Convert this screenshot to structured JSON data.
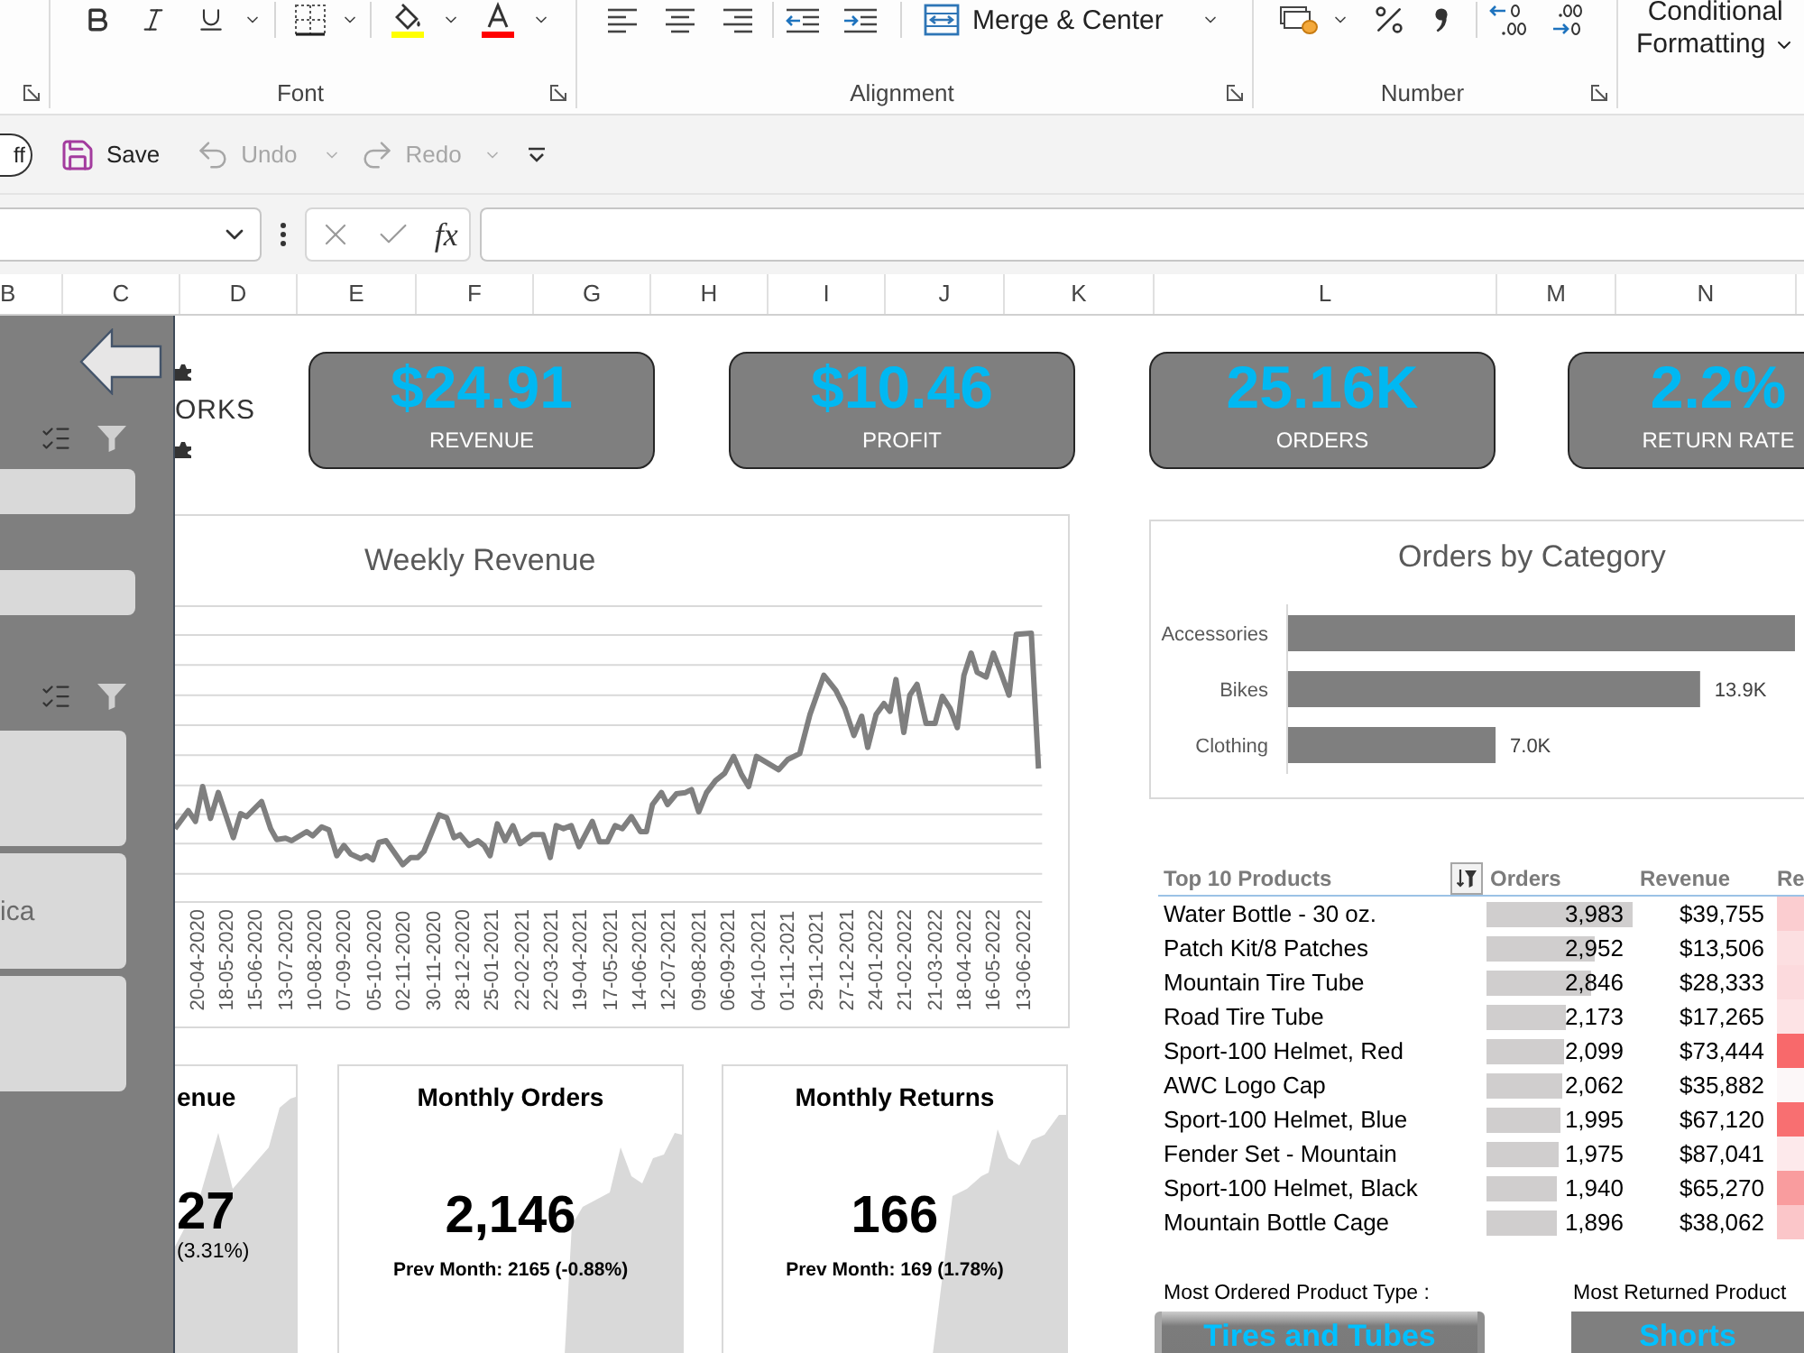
{
  "ribbon": {
    "groups": [
      {
        "kind": "font",
        "label": "Font"
      },
      {
        "kind": "alignment",
        "label": "Alignment",
        "merge_label": "Merge & Center"
      },
      {
        "kind": "number",
        "label": "Number"
      }
    ],
    "styles": {
      "lines": [
        "Conditional",
        "Formatting"
      ]
    }
  },
  "quick_access": {
    "toggle": {
      "label": "ff",
      "on": false
    },
    "buttons": [
      {
        "kind": "save",
        "label": "Save",
        "disabled": false
      },
      {
        "kind": "undo",
        "label": "Undo",
        "disabled": true
      },
      {
        "kind": "redo",
        "label": "Redo",
        "disabled": true
      }
    ]
  },
  "formula_bar": {
    "function_label": "fx"
  },
  "columns": [
    "B",
    "C",
    "D",
    "E",
    "F",
    "G",
    "H",
    "I",
    "J",
    "K",
    "L",
    "M",
    "N"
  ],
  "slicer_panel": {
    "slicers": [
      {
        "items": [
          {
            "selected": true
          },
          {
            "selected": true
          }
        ]
      },
      {
        "items": [
          {
            "selected": true
          },
          {
            "label": "ica",
            "selected": true
          },
          {
            "selected": true
          }
        ]
      }
    ]
  },
  "logo": {
    "text": "ORKS"
  },
  "kpis": [
    {
      "value": "$24.91",
      "label": "REVENUE"
    },
    {
      "value": "$10.46",
      "label": "PROFIT"
    },
    {
      "value": "25.16K",
      "label": "ORDERS"
    },
    {
      "value": "2.2%",
      "label": "RETURN RATE"
    }
  ],
  "weekly_revenue": {
    "title": "Weekly Revenue",
    "x_labels": [
      "20-04-2020",
      "18-05-2020",
      "15-06-2020",
      "13-07-2020",
      "10-08-2020",
      "07-09-2020",
      "05-10-2020",
      "02-11-2020",
      "30-11-2020",
      "28-12-2020",
      "25-01-2021",
      "22-02-2021",
      "22-03-2021",
      "19-04-2021",
      "17-05-2021",
      "14-06-2021",
      "12-07-2021",
      "09-08-2021",
      "06-09-2021",
      "04-10-2021",
      "01-11-2021",
      "29-11-2021",
      "27-12-2021",
      "24-01-2022",
      "21-02-2022",
      "21-03-2022",
      "18-04-2022",
      "16-05-2022",
      "13-06-2022"
    ]
  },
  "orders_by_category": {
    "chart_data": {
      "type": "bar",
      "orientation": "horizontal",
      "title": "Orders by Category",
      "categories": [
        "Accessories",
        "Bikes",
        "Clothing"
      ],
      "values": [
        17.1,
        13.9,
        7.0
      ],
      "value_labels": [
        null,
        "13.9K",
        "7.0K"
      ]
    }
  },
  "top_products": {
    "columns": [
      "Top 10 Products",
      "Orders",
      "Revenue",
      "Re"
    ],
    "rows": [
      {
        "product": "Water Bottle - 30 oz.",
        "orders": "3,983",
        "level": 1.0,
        "revenue": "$39,755",
        "color": "#fbcdd0"
      },
      {
        "product": "Patch Kit/8 Patches",
        "orders": "2,952",
        "level": 0.741,
        "revenue": "$13,506",
        "color": "#fcdfe1"
      },
      {
        "product": "Mountain Tire Tube",
        "orders": "2,846",
        "level": 0.715,
        "revenue": "$28,333",
        "color": "#fcdadd"
      },
      {
        "product": "Road Tire Tube",
        "orders": "2,173",
        "level": 0.546,
        "revenue": "$17,265",
        "color": "#fde3e5"
      },
      {
        "product": "Sport-100 Helmet, Red",
        "orders": "2,099",
        "level": 0.527,
        "revenue": "$73,444",
        "color": "#f8696b"
      },
      {
        "product": "AWC Logo Cap",
        "orders": "2,062",
        "level": 0.518,
        "revenue": "$35,882",
        "color": "#fcf7f8"
      },
      {
        "product": "Sport-100 Helmet, Blue",
        "orders": "1,995",
        "level": 0.501,
        "revenue": "$67,120",
        "color": "#f86f71"
      },
      {
        "product": "Fender Set - Mountain",
        "orders": "1,975",
        "level": 0.496,
        "revenue": "$87,041",
        "color": "#fde9eb"
      },
      {
        "product": "Sport-100 Helmet, Black",
        "orders": "1,940",
        "level": 0.487,
        "revenue": "$65,270",
        "color": "#f99c9e"
      },
      {
        "product": "Mountain Bottle Cage",
        "orders": "1,896",
        "level": 0.476,
        "revenue": "$38,062",
        "color": "#fbc6c9"
      }
    ]
  },
  "monthly_cards": [
    {
      "kind": "cut",
      "title": "enue",
      "value": "27",
      "change": "(3.31%)"
    },
    {
      "kind": "full",
      "title": "Monthly Orders",
      "value": "2,146",
      "change": "Prev Month: 2165 (-0.88%)"
    },
    {
      "kind": "full",
      "title": "Monthly Returns",
      "value": "166",
      "change": "Prev Month: 169 (1.78%)"
    }
  ],
  "most_ordered": {
    "label": "Most Ordered Product Type :",
    "value": "Tires and Tubes"
  },
  "most_returned": {
    "label": "Most Returned Product",
    "value": "Shorts"
  }
}
